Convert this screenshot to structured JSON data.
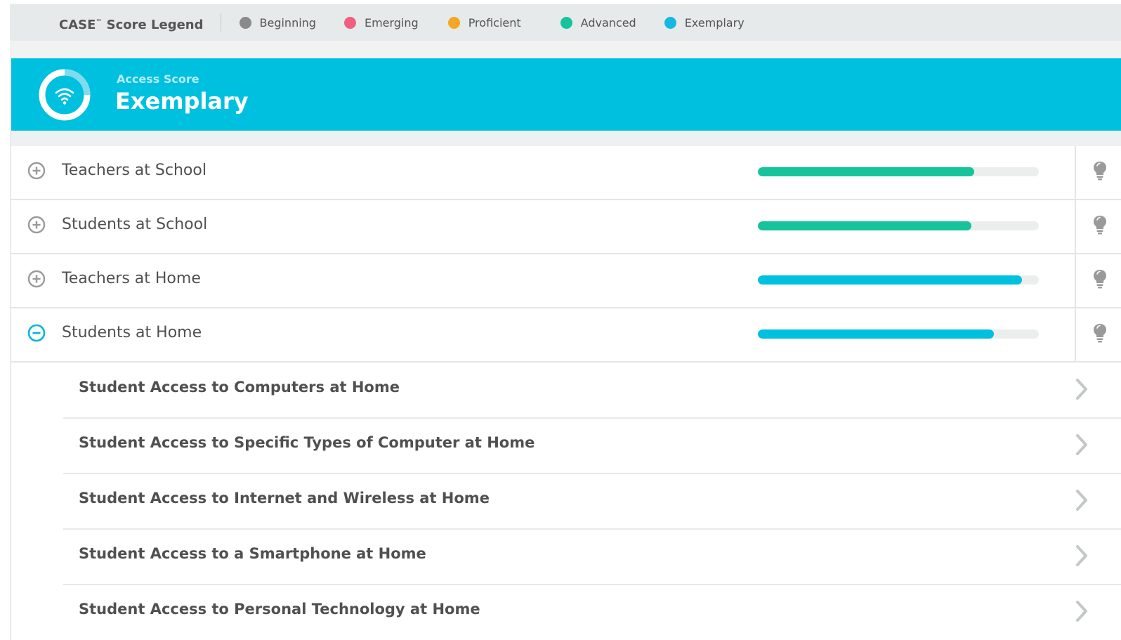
{
  "legend": {
    "title": "CASE",
    "title_mark": "™",
    "title_suffix": " Score Legend",
    "items": [
      {
        "label": "Beginning",
        "color": "#8a8a8a"
      },
      {
        "label": "Emerging",
        "color": "#f0607e"
      },
      {
        "label": "Proficient",
        "color": "#f5a623"
      },
      {
        "label": "Advanced",
        "color": "#17c39a"
      },
      {
        "label": "Exemplary",
        "color": "#16b8e3"
      }
    ]
  },
  "banner": {
    "subtitle": "Access Score",
    "title": "Exemplary",
    "icon": "wifi-icon",
    "color": "#00c0e0"
  },
  "categories": [
    {
      "label": "Teachers at School",
      "progress": 0.77,
      "color": "#17c39a",
      "expanded": false
    },
    {
      "label": "Students at School",
      "progress": 0.76,
      "color": "#17c39a",
      "expanded": false
    },
    {
      "label": "Teachers at Home",
      "progress": 0.94,
      "color": "#00c0e0",
      "expanded": false
    },
    {
      "label": "Students at Home",
      "progress": 0.84,
      "color": "#00c0e0",
      "expanded": true
    }
  ],
  "subitems": [
    {
      "label": "Student Access to Computers at Home"
    },
    {
      "label": "Student Access to Specific Types of Computer at Home"
    },
    {
      "label": "Student Access to Internet and Wireless at Home"
    },
    {
      "label": "Student Access to a Smartphone at Home"
    },
    {
      "label": "Student Access to Personal Technology at Home"
    }
  ]
}
